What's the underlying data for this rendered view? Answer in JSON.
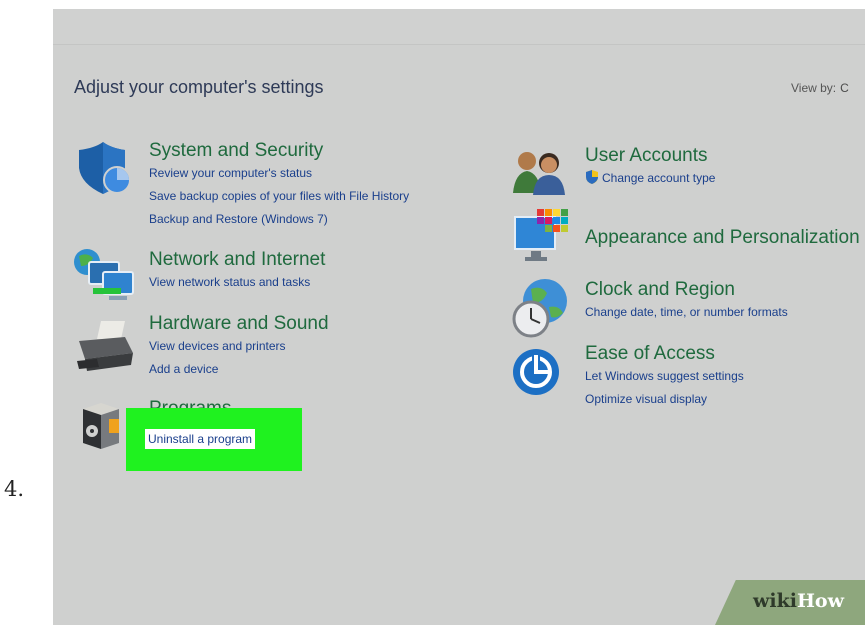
{
  "step_number": "4.",
  "page_title": "Adjust your computer's settings",
  "view_by": {
    "label": "View by:",
    "value": "C"
  },
  "left_categories": [
    {
      "title": "System and Security",
      "links": [
        "Review your computer's status",
        "Save backup copies of your files with File History",
        "Backup and Restore (Windows 7)"
      ]
    },
    {
      "title": "Network and Internet",
      "links": [
        "View network status and tasks"
      ]
    },
    {
      "title": "Hardware and Sound",
      "links": [
        "View devices and printers",
        "Add a device"
      ]
    },
    {
      "title": "Programs",
      "links": [
        "Uninstall a program"
      ]
    }
  ],
  "right_categories": [
    {
      "title": "User Accounts",
      "links": [
        "Change account type"
      ]
    },
    {
      "title": "Appearance and Personalization",
      "links": []
    },
    {
      "title": "Clock and Region",
      "links": [
        "Change date, time, or number formats"
      ]
    },
    {
      "title": "Ease of Access",
      "links": [
        "Let Windows suggest settings",
        "Optimize visual display"
      ]
    }
  ],
  "highlight_color": "#1ff21f",
  "icons": [
    "shield-icon",
    "network-icon",
    "printer-icon",
    "programs-icon",
    "user-accounts-icon",
    "appearance-icon",
    "clock-globe-icon",
    "ease-of-access-icon"
  ],
  "watermark": {
    "part1": "wiki",
    "part2": "How"
  }
}
